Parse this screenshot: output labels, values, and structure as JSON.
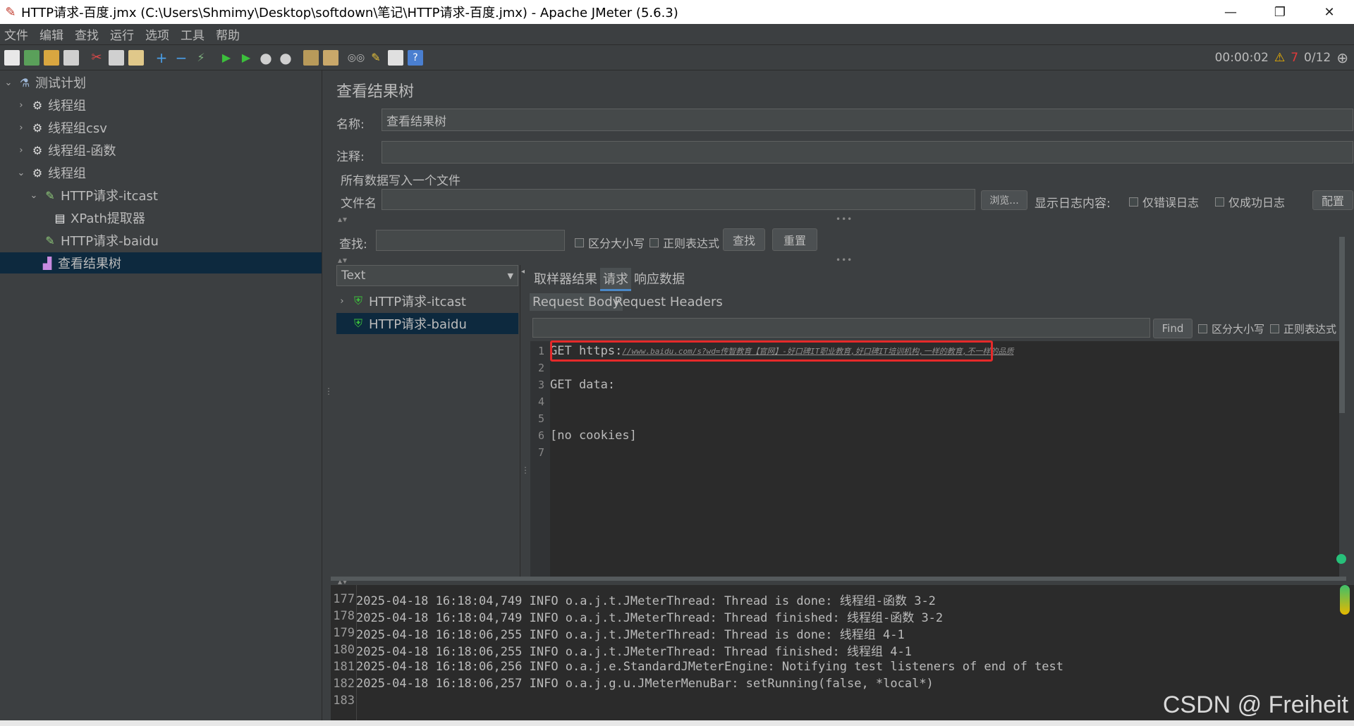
{
  "window": {
    "title": "HTTP请求-百度.jmx (C:\\Users\\Shmimy\\Desktop\\softdown\\笔记\\HTTP请求-百度.jmx) - Apache JMeter (5.6.3)",
    "minimize": "—",
    "restore": "❐",
    "close": "✕"
  },
  "menu": [
    "文件",
    "编辑",
    "查找",
    "运行",
    "选项",
    "工具",
    "帮助"
  ],
  "status": {
    "time": "00:00:02",
    "warnings": "7",
    "threads": "0/12"
  },
  "tree": [
    {
      "label": "测试计划",
      "icon": "flask-icon"
    },
    {
      "label": "线程组",
      "icon": "gear-icon"
    },
    {
      "label": "线程组csv",
      "icon": "gear-icon"
    },
    {
      "label": "线程组-函数",
      "icon": "gear-icon"
    },
    {
      "label": "线程组",
      "icon": "gear-icon"
    },
    {
      "label": "HTTP请求-itcast",
      "icon": "pencil-icon"
    },
    {
      "label": "XPath提取器",
      "icon": "document-icon"
    },
    {
      "label": "HTTP请求-baidu",
      "icon": "pencil-icon"
    },
    {
      "label": "查看结果树",
      "icon": "chart-icon"
    }
  ],
  "panel": {
    "title": "查看结果树",
    "name_label": "名称:",
    "name_value": "查看结果树",
    "comment_label": "注释:",
    "write_all_label": "所有数据写入一个文件",
    "filename_label": "文件名",
    "browse_button": "浏览...",
    "log_content_label": "显示日志内容:",
    "errors_only": "仅错误日志",
    "success_only": "仅成功日志",
    "configure_button": "配置",
    "search_label": "查找:",
    "case_sensitive": "区分大小写",
    "regex": "正则表达式",
    "find_button": "查找",
    "reset_button": "重置"
  },
  "results": {
    "renderer": "Text",
    "items": [
      "HTTP请求-itcast",
      "HTTP请求-baidu"
    ]
  },
  "tabs": [
    "取样器结果",
    "请求",
    "响应数据"
  ],
  "subtabs": [
    "Request Body",
    "Request Headers"
  ],
  "editor_find": {
    "button": "Find",
    "case_sensitive": "区分大小写",
    "regex": "正则表达式"
  },
  "editor": {
    "line_numbers": [
      "1",
      "2",
      "3",
      "4",
      "5",
      "6",
      "7"
    ],
    "line1_prefix": "GET https:",
    "line1_url": "//www.baidu.com/s?wd=传智教育【官网】-好口碑IT职业教育,好口碑IT培训机构,一样的教育,不一样的品质",
    "line3": "GET data:",
    "line6": "[no cookies]"
  },
  "log": [
    {
      "n": "177",
      "text": "2025-04-18 16:18:04,749 INFO o.a.j.t.JMeterThread: Thread is done: 线程组-函数 3-2"
    },
    {
      "n": "178",
      "text": "2025-04-18 16:18:04,749 INFO o.a.j.t.JMeterThread: Thread finished: 线程组-函数 3-2"
    },
    {
      "n": "179",
      "text": "2025-04-18 16:18:06,255 INFO o.a.j.t.JMeterThread: Thread is done: 线程组 4-1"
    },
    {
      "n": "180",
      "text": "2025-04-18 16:18:06,255 INFO o.a.j.t.JMeterThread: Thread finished: 线程组 4-1"
    },
    {
      "n": "181",
      "text": "2025-04-18 16:18:06,256 INFO o.a.j.e.StandardJMeterEngine: Notifying test listeners of end of test"
    },
    {
      "n": "182",
      "text": "2025-04-18 16:18:06,257 INFO o.a.j.g.u.JMeterMenuBar: setRunning(false, *local*)"
    },
    {
      "n": "183",
      "text": ""
    }
  ],
  "watermark": "CSDN @ Freiheit"
}
